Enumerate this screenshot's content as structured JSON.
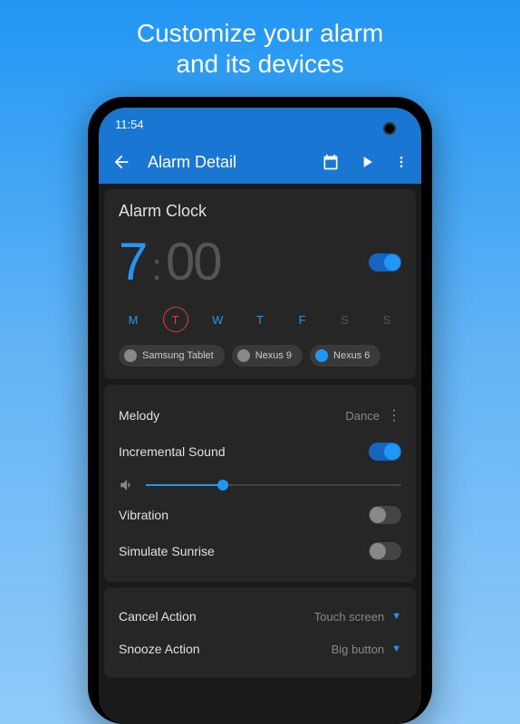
{
  "promo": {
    "line1": "Customize your alarm",
    "line2": "and its devices"
  },
  "status_bar": {
    "time": "11:54"
  },
  "header": {
    "title": "Alarm Detail"
  },
  "alarm": {
    "label": "Alarm Clock",
    "hour": "7",
    "minutes": "00",
    "enabled": true,
    "days": [
      {
        "label": "M",
        "active": true,
        "circled": false
      },
      {
        "label": "T",
        "active": true,
        "circled": true
      },
      {
        "label": "W",
        "active": true,
        "circled": false
      },
      {
        "label": "T",
        "active": true,
        "circled": false
      },
      {
        "label": "F",
        "active": true,
        "circled": false
      },
      {
        "label": "S",
        "active": false,
        "circled": false
      },
      {
        "label": "S",
        "active": false,
        "circled": false
      }
    ],
    "devices": [
      {
        "name": "Samsung Tablet",
        "selected": false
      },
      {
        "name": "Nexus 9",
        "selected": false
      },
      {
        "name": "Nexus 6",
        "selected": true
      }
    ]
  },
  "sound": {
    "melody_label": "Melody",
    "melody_value": "Dance",
    "incremental_label": "Incremental Sound",
    "incremental_on": true,
    "volume_percent": 30,
    "vibration_label": "Vibration",
    "vibration_on": false,
    "sunrise_label": "Simulate Sunrise",
    "sunrise_on": false
  },
  "actions": {
    "cancel_label": "Cancel Action",
    "cancel_value": "Touch screen",
    "snooze_label": "Snooze Action",
    "snooze_value": "Big button"
  }
}
